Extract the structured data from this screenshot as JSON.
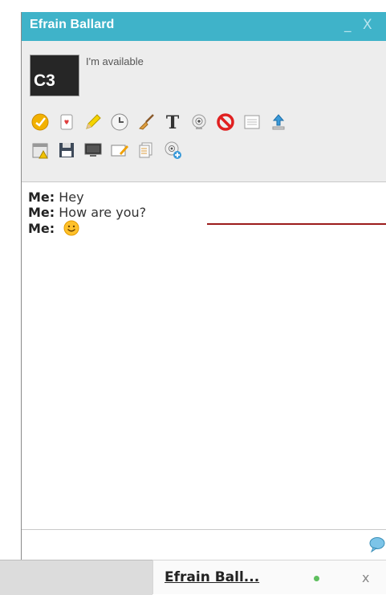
{
  "window": {
    "title": "Efrain Ballard",
    "minimize_label": "_",
    "close_label": "X"
  },
  "profile": {
    "avatar_text": "C3",
    "status": "I'm available"
  },
  "toolbar": {
    "row1": [
      "emoticon-icon",
      "card-icon",
      "pencil-icon",
      "clock-icon",
      "broom-icon",
      "text-icon",
      "webcam-icon",
      "block-icon",
      "notepad-icon",
      "upload-icon"
    ],
    "row2": [
      "calendar-warning-icon",
      "save-icon",
      "screen-icon",
      "whiteboard-icon",
      "documents-icon",
      "webcam-add-icon"
    ]
  },
  "messages": [
    {
      "sender": "Me:",
      "text": "Hey"
    },
    {
      "sender": "Me:",
      "text": "How are you?"
    },
    {
      "sender": "Me:",
      "emoticon": "smiley-icon"
    }
  ],
  "taskbar": {
    "tab_label": "Efrain Ball...",
    "status_color": "#5fbf5f",
    "close_label": "x"
  },
  "colors": {
    "titlebar": "#3fb3c9",
    "annotation_line": "#9b1c1c"
  }
}
